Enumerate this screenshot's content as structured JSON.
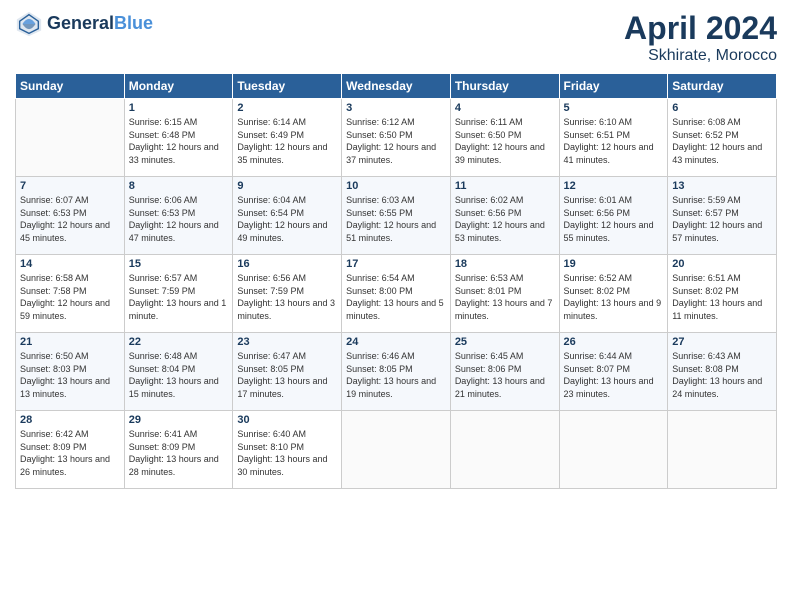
{
  "header": {
    "logo_line1": "General",
    "logo_line2": "Blue",
    "month_title": "April 2024",
    "location": "Skhirate, Morocco"
  },
  "weekdays": [
    "Sunday",
    "Monday",
    "Tuesday",
    "Wednesday",
    "Thursday",
    "Friday",
    "Saturday"
  ],
  "weeks": [
    [
      {
        "day": "",
        "sunrise": "",
        "sunset": "",
        "daylight": ""
      },
      {
        "day": "1",
        "sunrise": "Sunrise: 6:15 AM",
        "sunset": "Sunset: 6:48 PM",
        "daylight": "Daylight: 12 hours and 33 minutes."
      },
      {
        "day": "2",
        "sunrise": "Sunrise: 6:14 AM",
        "sunset": "Sunset: 6:49 PM",
        "daylight": "Daylight: 12 hours and 35 minutes."
      },
      {
        "day": "3",
        "sunrise": "Sunrise: 6:12 AM",
        "sunset": "Sunset: 6:50 PM",
        "daylight": "Daylight: 12 hours and 37 minutes."
      },
      {
        "day": "4",
        "sunrise": "Sunrise: 6:11 AM",
        "sunset": "Sunset: 6:50 PM",
        "daylight": "Daylight: 12 hours and 39 minutes."
      },
      {
        "day": "5",
        "sunrise": "Sunrise: 6:10 AM",
        "sunset": "Sunset: 6:51 PM",
        "daylight": "Daylight: 12 hours and 41 minutes."
      },
      {
        "day": "6",
        "sunrise": "Sunrise: 6:08 AM",
        "sunset": "Sunset: 6:52 PM",
        "daylight": "Daylight: 12 hours and 43 minutes."
      }
    ],
    [
      {
        "day": "7",
        "sunrise": "Sunrise: 6:07 AM",
        "sunset": "Sunset: 6:53 PM",
        "daylight": "Daylight: 12 hours and 45 minutes."
      },
      {
        "day": "8",
        "sunrise": "Sunrise: 6:06 AM",
        "sunset": "Sunset: 6:53 PM",
        "daylight": "Daylight: 12 hours and 47 minutes."
      },
      {
        "day": "9",
        "sunrise": "Sunrise: 6:04 AM",
        "sunset": "Sunset: 6:54 PM",
        "daylight": "Daylight: 12 hours and 49 minutes."
      },
      {
        "day": "10",
        "sunrise": "Sunrise: 6:03 AM",
        "sunset": "Sunset: 6:55 PM",
        "daylight": "Daylight: 12 hours and 51 minutes."
      },
      {
        "day": "11",
        "sunrise": "Sunrise: 6:02 AM",
        "sunset": "Sunset: 6:56 PM",
        "daylight": "Daylight: 12 hours and 53 minutes."
      },
      {
        "day": "12",
        "sunrise": "Sunrise: 6:01 AM",
        "sunset": "Sunset: 6:56 PM",
        "daylight": "Daylight: 12 hours and 55 minutes."
      },
      {
        "day": "13",
        "sunrise": "Sunrise: 5:59 AM",
        "sunset": "Sunset: 6:57 PM",
        "daylight": "Daylight: 12 hours and 57 minutes."
      }
    ],
    [
      {
        "day": "14",
        "sunrise": "Sunrise: 6:58 AM",
        "sunset": "Sunset: 7:58 PM",
        "daylight": "Daylight: 12 hours and 59 minutes."
      },
      {
        "day": "15",
        "sunrise": "Sunrise: 6:57 AM",
        "sunset": "Sunset: 7:59 PM",
        "daylight": "Daylight: 13 hours and 1 minute."
      },
      {
        "day": "16",
        "sunrise": "Sunrise: 6:56 AM",
        "sunset": "Sunset: 7:59 PM",
        "daylight": "Daylight: 13 hours and 3 minutes."
      },
      {
        "day": "17",
        "sunrise": "Sunrise: 6:54 AM",
        "sunset": "Sunset: 8:00 PM",
        "daylight": "Daylight: 13 hours and 5 minutes."
      },
      {
        "day": "18",
        "sunrise": "Sunrise: 6:53 AM",
        "sunset": "Sunset: 8:01 PM",
        "daylight": "Daylight: 13 hours and 7 minutes."
      },
      {
        "day": "19",
        "sunrise": "Sunrise: 6:52 AM",
        "sunset": "Sunset: 8:02 PM",
        "daylight": "Daylight: 13 hours and 9 minutes."
      },
      {
        "day": "20",
        "sunrise": "Sunrise: 6:51 AM",
        "sunset": "Sunset: 8:02 PM",
        "daylight": "Daylight: 13 hours and 11 minutes."
      }
    ],
    [
      {
        "day": "21",
        "sunrise": "Sunrise: 6:50 AM",
        "sunset": "Sunset: 8:03 PM",
        "daylight": "Daylight: 13 hours and 13 minutes."
      },
      {
        "day": "22",
        "sunrise": "Sunrise: 6:48 AM",
        "sunset": "Sunset: 8:04 PM",
        "daylight": "Daylight: 13 hours and 15 minutes."
      },
      {
        "day": "23",
        "sunrise": "Sunrise: 6:47 AM",
        "sunset": "Sunset: 8:05 PM",
        "daylight": "Daylight: 13 hours and 17 minutes."
      },
      {
        "day": "24",
        "sunrise": "Sunrise: 6:46 AM",
        "sunset": "Sunset: 8:05 PM",
        "daylight": "Daylight: 13 hours and 19 minutes."
      },
      {
        "day": "25",
        "sunrise": "Sunrise: 6:45 AM",
        "sunset": "Sunset: 8:06 PM",
        "daylight": "Daylight: 13 hours and 21 minutes."
      },
      {
        "day": "26",
        "sunrise": "Sunrise: 6:44 AM",
        "sunset": "Sunset: 8:07 PM",
        "daylight": "Daylight: 13 hours and 23 minutes."
      },
      {
        "day": "27",
        "sunrise": "Sunrise: 6:43 AM",
        "sunset": "Sunset: 8:08 PM",
        "daylight": "Daylight: 13 hours and 24 minutes."
      }
    ],
    [
      {
        "day": "28",
        "sunrise": "Sunrise: 6:42 AM",
        "sunset": "Sunset: 8:09 PM",
        "daylight": "Daylight: 13 hours and 26 minutes."
      },
      {
        "day": "29",
        "sunrise": "Sunrise: 6:41 AM",
        "sunset": "Sunset: 8:09 PM",
        "daylight": "Daylight: 13 hours and 28 minutes."
      },
      {
        "day": "30",
        "sunrise": "Sunrise: 6:40 AM",
        "sunset": "Sunset: 8:10 PM",
        "daylight": "Daylight: 13 hours and 30 minutes."
      },
      {
        "day": "",
        "sunrise": "",
        "sunset": "",
        "daylight": ""
      },
      {
        "day": "",
        "sunrise": "",
        "sunset": "",
        "daylight": ""
      },
      {
        "day": "",
        "sunrise": "",
        "sunset": "",
        "daylight": ""
      },
      {
        "day": "",
        "sunrise": "",
        "sunset": "",
        "daylight": ""
      }
    ]
  ]
}
